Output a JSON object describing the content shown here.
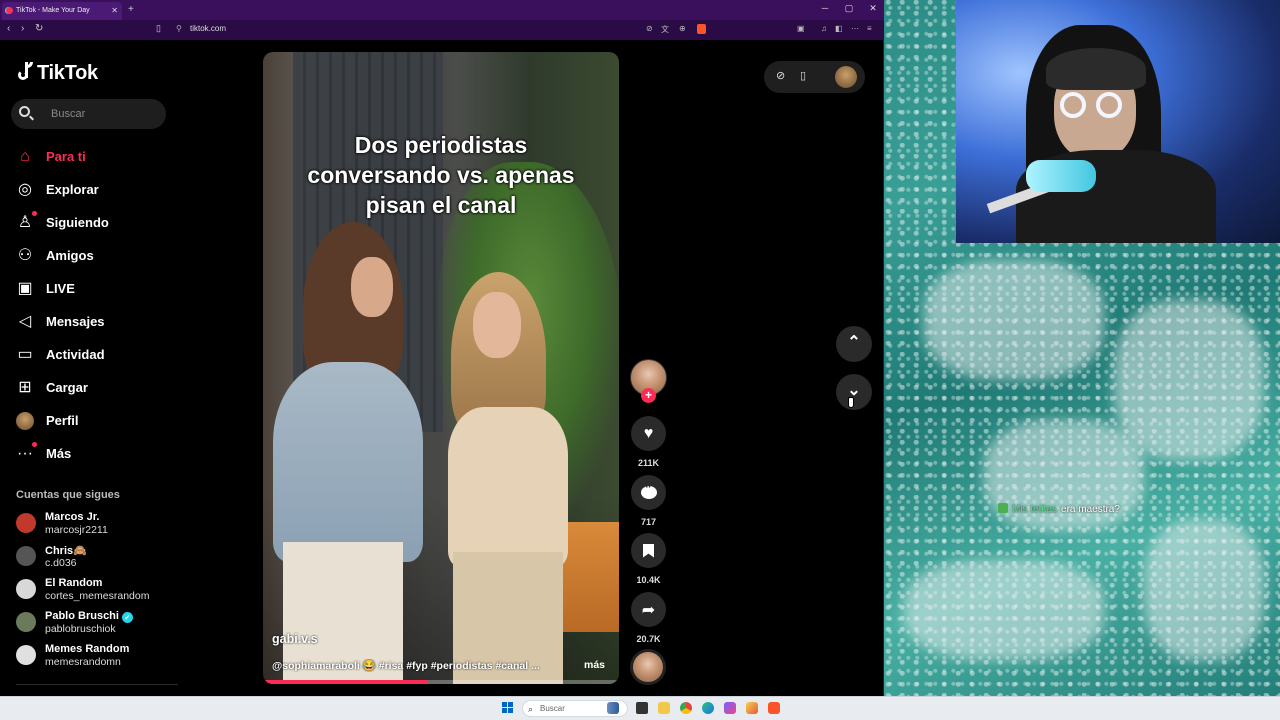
{
  "browser": {
    "tab_title": "TikTok - Make Your Day",
    "tab_close": "✕",
    "new_tab": "+",
    "url": "tiktok.com",
    "window_controls": [
      "─",
      "▢",
      "✕"
    ]
  },
  "tiktok": {
    "logo": "TikTok",
    "search_placeholder": "Buscar",
    "nav": [
      {
        "label": "Para ti",
        "icon": "home-icon",
        "glyph": "⌂",
        "active": true
      },
      {
        "label": "Explorar",
        "icon": "compass-icon",
        "glyph": "◎"
      },
      {
        "label": "Siguiendo",
        "icon": "following-icon",
        "glyph": "♙",
        "dot": true
      },
      {
        "label": "Amigos",
        "icon": "friends-icon",
        "glyph": "⚇"
      },
      {
        "label": "LIVE",
        "icon": "live-icon",
        "glyph": "▣"
      },
      {
        "label": "Mensajes",
        "icon": "messages-icon",
        "glyph": "◁"
      },
      {
        "label": "Actividad",
        "icon": "activity-icon",
        "glyph": "▭"
      },
      {
        "label": "Cargar",
        "icon": "upload-icon",
        "glyph": "⊞"
      },
      {
        "label": "Perfil",
        "icon": "profile-avatar-icon",
        "glyph": ""
      },
      {
        "label": "Más",
        "icon": "more-icon",
        "glyph": "···",
        "dot": true
      }
    ],
    "following_title": "Cuentas que sigues",
    "following": [
      {
        "name": "Marcos Jr.",
        "user": "marcosjr2211",
        "color": "#c0392b"
      },
      {
        "name": "Chris🙈",
        "user": "c.d036",
        "color": "#555555"
      },
      {
        "name": "El Random",
        "user": "cortes_memesrandom",
        "color": "#d8d8d8"
      },
      {
        "name": "Pablo Bruschi",
        "user": "pablobruschiok",
        "color": "#6b7a5a",
        "verified": true
      },
      {
        "name": "Memes Random",
        "user": "memesrandomn",
        "color": "#e0e0e0"
      }
    ]
  },
  "video": {
    "caption": "Dos periodistas conversando vs. apenas pisan el canal",
    "author": "gabi.v.s",
    "description": "@sophiamaraboli 😂 #risa #fyp #periodistas #canal ...",
    "more": "más",
    "progress_fraction": 0.46
  },
  "actions": {
    "follow_plus": "+",
    "likes": "211K",
    "comments": "717",
    "saves": "10.4K",
    "shares": "20.7K"
  },
  "nav_arrows": {
    "up": "⌃",
    "down": "⌄"
  },
  "stream": {
    "chat_user": "Mis tetitas",
    "chat_text": "era maestra?"
  },
  "taskbar": {
    "search_label": "Buscar",
    "search_icon": "⌕"
  },
  "colors": {
    "accent": "#fe2c55",
    "browser_frame": "#3a0f5c",
    "taskbar": "#e8ecf0"
  }
}
